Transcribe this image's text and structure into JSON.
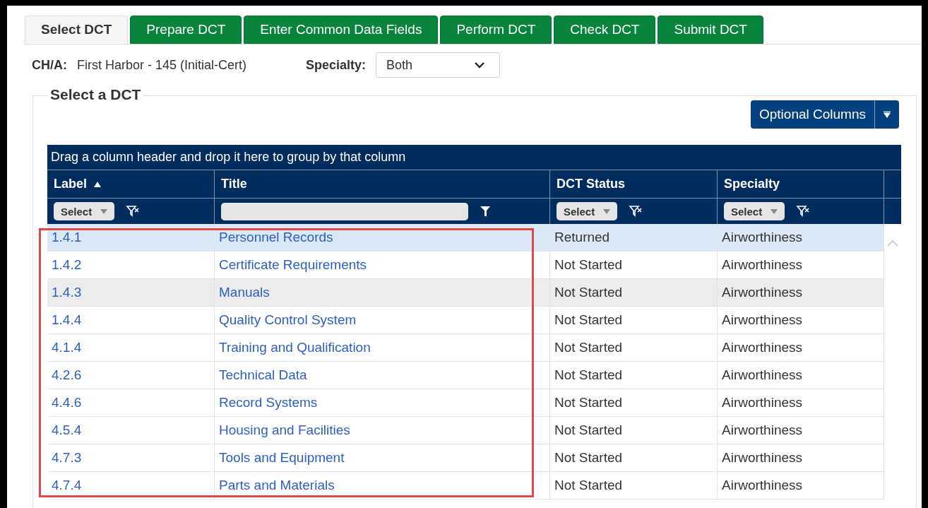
{
  "tabs": [
    {
      "label": "Select DCT",
      "selected": true
    },
    {
      "label": "Prepare DCT",
      "selected": false
    },
    {
      "label": "Enter Common Data Fields",
      "selected": false
    },
    {
      "label": "Perform DCT",
      "selected": false
    },
    {
      "label": "Check DCT",
      "selected": false
    },
    {
      "label": "Submit DCT",
      "selected": false
    }
  ],
  "cha": {
    "label": "CH/A:",
    "value": "First Harbor - 145 (Initial-Cert)"
  },
  "specialty": {
    "label": "Specialty:",
    "value": "Both"
  },
  "section": {
    "title": "Select a DCT"
  },
  "optional_columns": {
    "label": "Optional Columns"
  },
  "grid": {
    "group_hint": "Drag a column header and drop it here to group by that column",
    "columns": [
      {
        "label": "Label",
        "sorted": true,
        "kind": "select",
        "filter_label": "Select"
      },
      {
        "label": "Title",
        "sorted": false,
        "kind": "text"
      },
      {
        "label": "DCT Status",
        "sorted": false,
        "kind": "select",
        "filter_label": "Select"
      },
      {
        "label": "Specialty",
        "sorted": false,
        "kind": "select",
        "filter_label": "Select"
      }
    ],
    "rows": [
      {
        "label": "1.4.1",
        "title": "Personnel Records",
        "status": "Returned",
        "specialty": "Airworthiness",
        "selected": true,
        "hovered": false
      },
      {
        "label": "1.4.2",
        "title": "Certificate Requirements",
        "status": "Not Started",
        "specialty": "Airworthiness",
        "selected": false,
        "hovered": false
      },
      {
        "label": "1.4.3",
        "title": "Manuals",
        "status": "Not Started",
        "specialty": "Airworthiness",
        "selected": false,
        "hovered": true
      },
      {
        "label": "1.4.4",
        "title": "Quality Control System",
        "status": "Not Started",
        "specialty": "Airworthiness",
        "selected": false,
        "hovered": false
      },
      {
        "label": "4.1.4",
        "title": "Training and Qualification",
        "status": "Not Started",
        "specialty": "Airworthiness",
        "selected": false,
        "hovered": false
      },
      {
        "label": "4.2.6",
        "title": "Technical Data",
        "status": "Not Started",
        "specialty": "Airworthiness",
        "selected": false,
        "hovered": false
      },
      {
        "label": "4.4.6",
        "title": "Record Systems",
        "status": "Not Started",
        "specialty": "Airworthiness",
        "selected": false,
        "hovered": false
      },
      {
        "label": "4.5.4",
        "title": "Housing and Facilities",
        "status": "Not Started",
        "specialty": "Airworthiness",
        "selected": false,
        "hovered": false
      },
      {
        "label": "4.7.3",
        "title": "Tools and Equipment",
        "status": "Not Started",
        "specialty": "Airworthiness",
        "selected": false,
        "hovered": false
      },
      {
        "label": "4.7.4",
        "title": "Parts and Materials",
        "status": "Not Started",
        "specialty": "Airworthiness",
        "selected": false,
        "hovered": false
      }
    ]
  }
}
